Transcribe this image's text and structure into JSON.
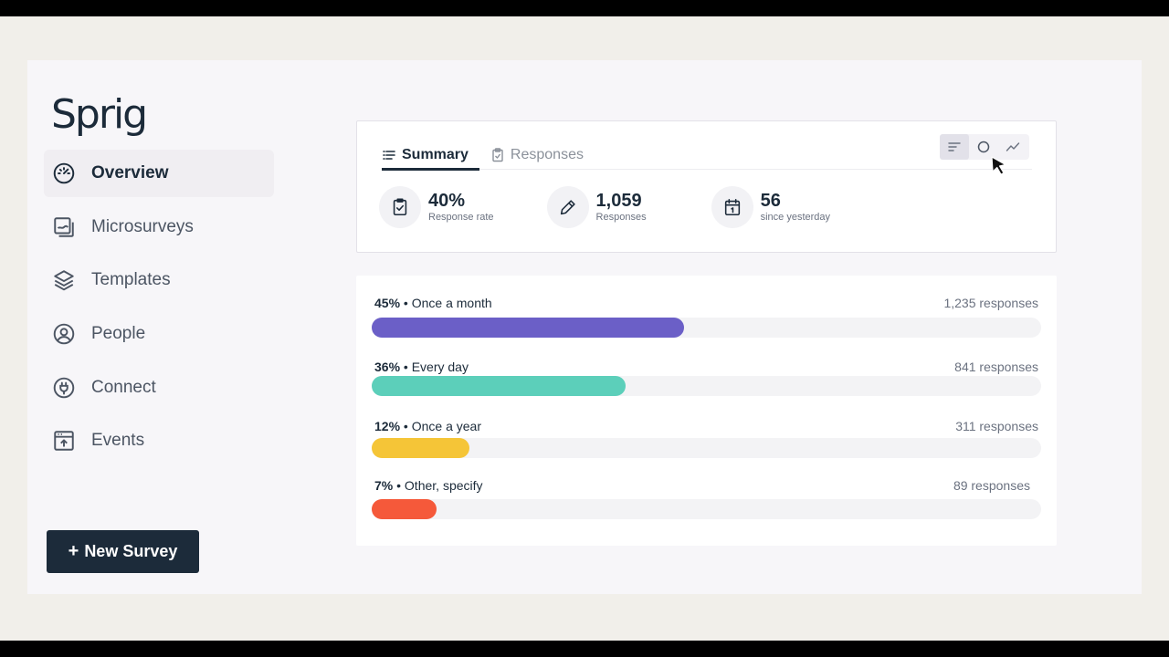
{
  "app": {
    "logo": "Sprig"
  },
  "sidebar": {
    "items": [
      {
        "label": "Overview",
        "icon": "gauge-icon",
        "active": true
      },
      {
        "label": "Microsurveys",
        "icon": "microsurvey-icon",
        "active": false
      },
      {
        "label": "Templates",
        "icon": "layers-icon",
        "active": false
      },
      {
        "label": "People",
        "icon": "user-circle-icon",
        "active": false
      },
      {
        "label": "Connect",
        "icon": "plug-icon",
        "active": false
      },
      {
        "label": "Events",
        "icon": "event-icon",
        "active": false
      }
    ],
    "new_survey_label": "New Survey"
  },
  "summary": {
    "tabs": [
      {
        "label": "Summary",
        "icon": "list-icon",
        "active": true
      },
      {
        "label": "Responses",
        "icon": "clipboard-icon",
        "active": false
      }
    ],
    "view_toggle": [
      "bar-view-icon",
      "donut-view-icon",
      "line-view-icon"
    ],
    "stats": [
      {
        "value": "40%",
        "label": "Response rate",
        "icon": "clipboard-check-icon"
      },
      {
        "value": "1,059",
        "label": "Responses",
        "icon": "pencil-icon"
      },
      {
        "value": "56",
        "label": "since yesterday",
        "icon": "calendar-icon"
      }
    ]
  },
  "distribution": {
    "rows": [
      {
        "percent": "45%",
        "label": "Once a month",
        "count": "1,235 responses",
        "fraction": 0.466,
        "color": "#6b5fc7"
      },
      {
        "percent": "36%",
        "label": "Every day",
        "count": "841 responses",
        "fraction": 0.379,
        "color": "#5ccfba"
      },
      {
        "percent": "12%",
        "label": "Once a year",
        "count": "311 responses",
        "fraction": 0.146,
        "color": "#f5c537"
      },
      {
        "percent": "7%",
        "label": "Other, specify",
        "count": "89 responses",
        "fraction": 0.097,
        "color": "#f5593a"
      }
    ]
  }
}
